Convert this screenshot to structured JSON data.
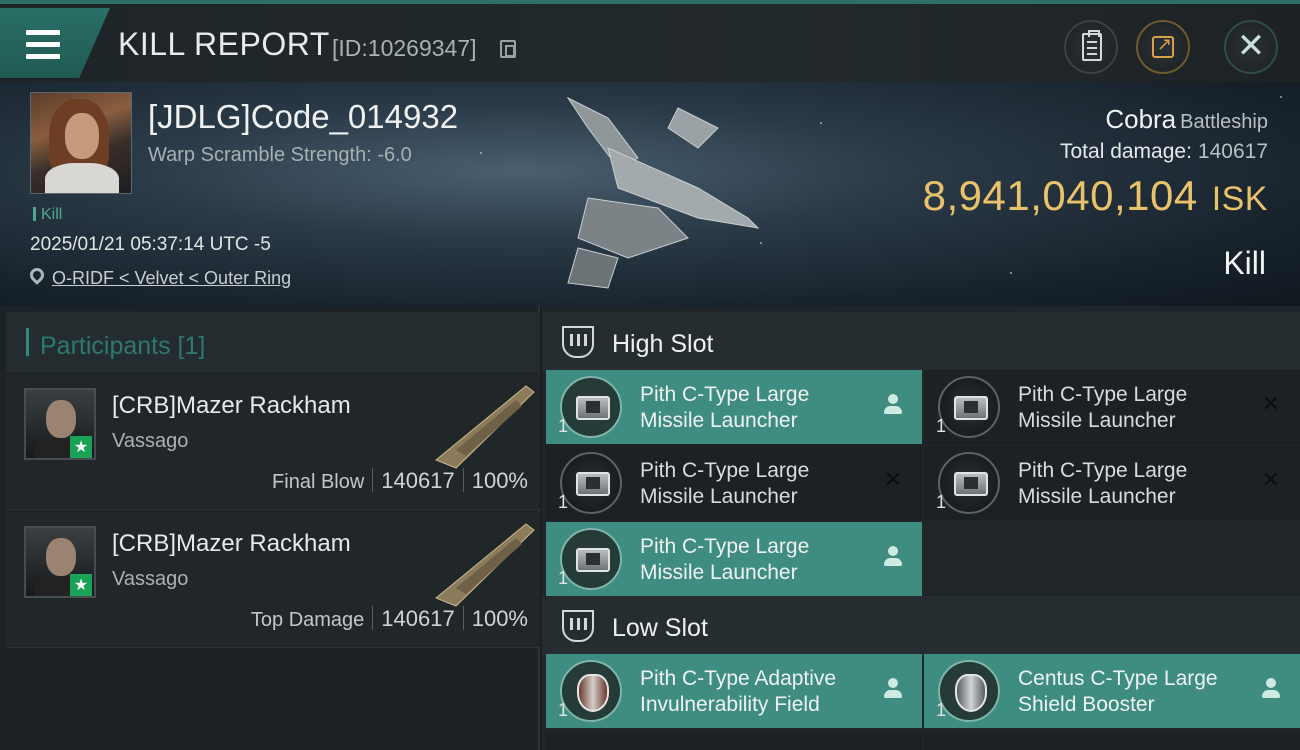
{
  "header": {
    "title": "KILL REPORT",
    "report_id": "[ID:10269347]"
  },
  "victim": {
    "name": "[JDLG]Code_014932",
    "warp_scramble": "Warp Scramble Strength: -6.0",
    "tag": "Kill",
    "timestamp": "2025/01/21 05:37:14 UTC -5",
    "location": "O-RIDF < Velvet < Outer Ring",
    "ship_name": "Cobra",
    "ship_class": "Battleship",
    "total_damage_label": "Total damage:",
    "total_damage_value": "140617",
    "isk_value": "8,941,040,104",
    "isk_unit": "ISK",
    "result": "Kill"
  },
  "participants": {
    "label": "Participants [1]",
    "items": [
      {
        "name": "[CRB]Mazer Rackham",
        "ship": "Vassago",
        "role": "Final Blow",
        "damage": "140617",
        "percent": "100%"
      },
      {
        "name": "[CRB]Mazer Rackham",
        "ship": "Vassago",
        "role": "Top Damage",
        "damage": "140617",
        "percent": "100%"
      }
    ]
  },
  "fitting": {
    "high_slot_label": "High Slot",
    "low_slot_label": "Low Slot",
    "high": [
      {
        "name_l1": "Pith C-Type Large",
        "name_l2": "Missile Launcher",
        "qty": "1",
        "state": "dropped"
      },
      {
        "name_l1": "Pith C-Type Large",
        "name_l2": "Missile Launcher",
        "qty": "1",
        "state": "destroyed"
      },
      {
        "name_l1": "Pith C-Type Large",
        "name_l2": "Missile Launcher",
        "qty": "1",
        "state": "destroyed"
      },
      {
        "name_l1": "Pith C-Type Large",
        "name_l2": "Missile Launcher",
        "qty": "1",
        "state": "destroyed"
      },
      {
        "name_l1": "Pith C-Type Large",
        "name_l2": "Missile Launcher",
        "qty": "1",
        "state": "dropped"
      }
    ],
    "low": [
      {
        "name_l1": "Pith C-Type Adaptive",
        "name_l2": "Invulnerability Field",
        "qty": "1",
        "state": "dropped"
      },
      {
        "name_l1": "Centus C-Type Large",
        "name_l2": "Shield Booster",
        "qty": "1",
        "state": "dropped"
      }
    ]
  },
  "colors": {
    "accent_teal": "#3e8d80",
    "isk_gold": "#e9c26a",
    "star_green": "#18a356"
  }
}
